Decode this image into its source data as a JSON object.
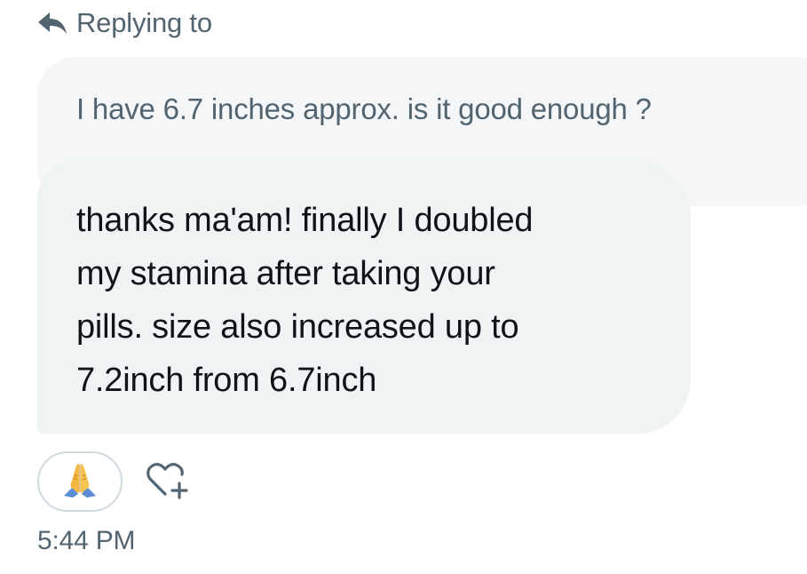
{
  "reply_header": {
    "label": "Replying to",
    "icon": "reply-arrow-icon"
  },
  "quoted_message": {
    "text": "I have 6.7 inches approx. is it good enough ?"
  },
  "message": {
    "lines": [
      "thanks ma'am! finally I doubled",
      "my stamina after taking your",
      "pills. size also increased up to",
      "7.2inch from 6.7inch"
    ]
  },
  "reactions": {
    "items": [
      {
        "emoji": "🙏",
        "icon": "folded-hands-icon"
      }
    ],
    "add_reaction_icon": "heart-plus-icon"
  },
  "timestamp": "5:44 PM",
  "colors": {
    "secondary_text": "#536471",
    "primary_text": "#0f1419",
    "bubble": "#eff3f4",
    "quoted_bubble": "#f4f6f8",
    "border": "#cfd9de"
  }
}
